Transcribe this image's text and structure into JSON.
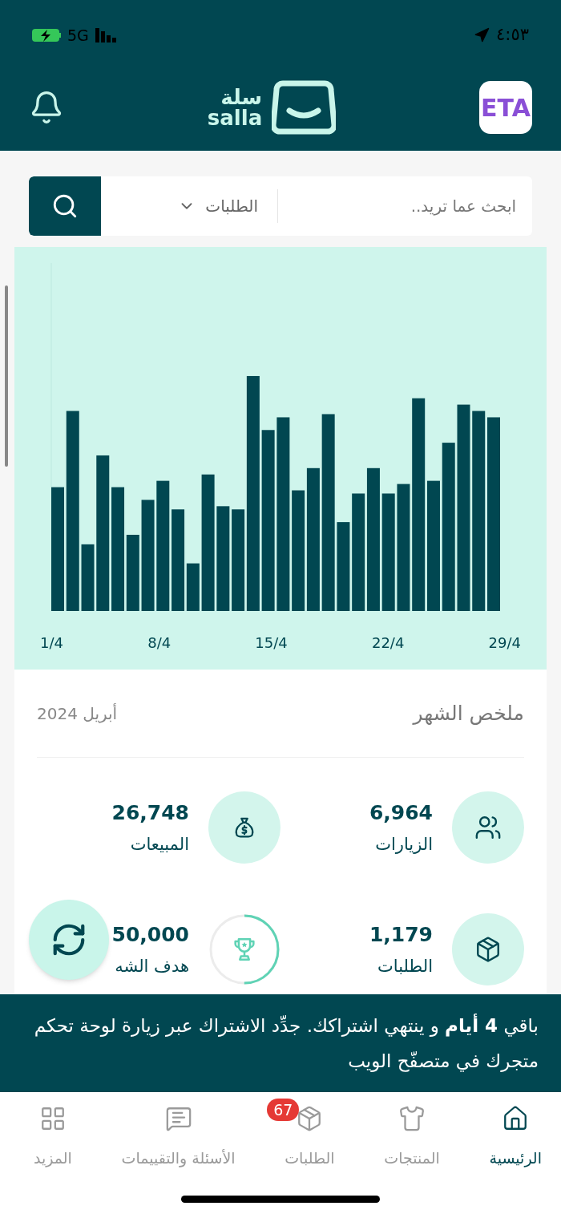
{
  "status_bar": {
    "network": "5G",
    "time": "٤:٥٣"
  },
  "header": {
    "store_logo": "ETA",
    "brand_arabic": "سلة",
    "brand_latin": "salla"
  },
  "search": {
    "placeholder": "ابحث عما تريد..",
    "scope": "الطلبات"
  },
  "chart": {
    "x_labels": [
      "29/4",
      "22/4",
      "15/4",
      "8/4",
      "1/4"
    ]
  },
  "summary": {
    "title": "ملخص الشهر",
    "period": "أبريل 2024",
    "stats": [
      {
        "kind": "visits",
        "value": "6,964",
        "label": "الزيارات"
      },
      {
        "kind": "sales",
        "value": "26,748",
        "label": "المبيعات"
      },
      {
        "kind": "orders",
        "value": "1,179",
        "label": "الطلبات"
      },
      {
        "kind": "goal",
        "value": "50,000",
        "label": "هدف الشه"
      }
    ]
  },
  "banner": {
    "text": "باقي **4 أيام** و ينتهي اشتراكك. جدِّد الاشتراك عبر زيارة لوحة تحكم متجرك في متصفّح الويب"
  },
  "nav": [
    {
      "kind": "home",
      "label": "الرئيسية",
      "selected": true
    },
    {
      "kind": "products",
      "label": "المنتجات",
      "selected": false
    },
    {
      "kind": "orders",
      "label": "الطلبات",
      "selected": false,
      "badge": "67"
    },
    {
      "kind": "reviews",
      "label": "الأسئلة والتقييمات",
      "selected": false
    },
    {
      "kind": "more",
      "label": "المزيد",
      "selected": false
    }
  ]
}
